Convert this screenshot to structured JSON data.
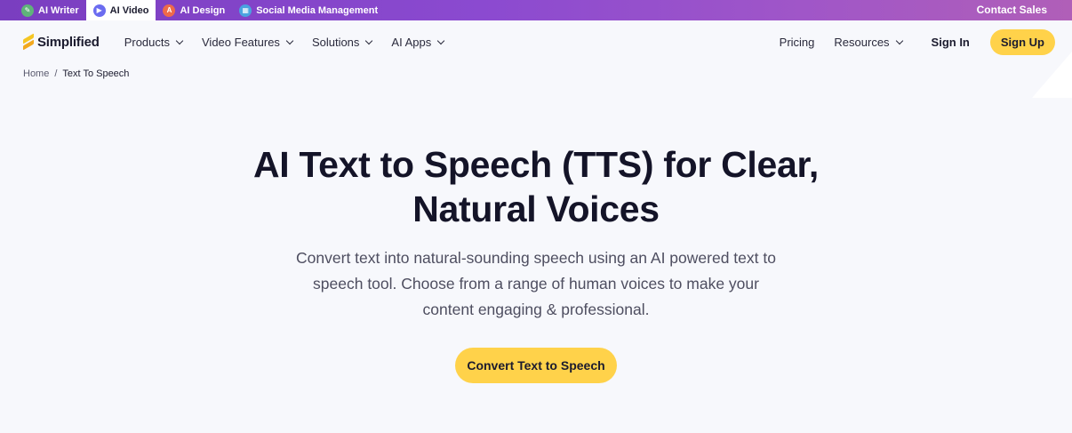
{
  "topbar": {
    "tabs": [
      {
        "label": "AI Writer",
        "icon": "writer-icon",
        "active": false
      },
      {
        "label": "AI Video",
        "icon": "video-icon",
        "active": true
      },
      {
        "label": "AI Design",
        "icon": "design-icon",
        "active": false
      },
      {
        "label": "Social Media Management",
        "icon": "calendar-icon",
        "active": false
      }
    ],
    "contact": "Contact Sales"
  },
  "nav": {
    "logo": "Simplified",
    "menu": [
      "Products",
      "Video Features",
      "Solutions",
      "AI Apps"
    ],
    "pricing": "Pricing",
    "resources": "Resources",
    "signin": "Sign In",
    "signup": "Sign Up"
  },
  "breadcrumb": {
    "home": "Home",
    "separator": "/",
    "current": "Text To Speech"
  },
  "hero": {
    "title_line1": "AI Text to Speech (TTS) for Clear,",
    "title_line2": "Natural Voices",
    "subtitle": "Convert text into natural-sounding speech using an AI powered text to speech tool. Choose from a range of human voices to make your content engaging & professional.",
    "cta": "Convert Text to Speech"
  },
  "colors": {
    "accent_yellow": "#ffd24a",
    "topbar_purple": "#8b4ad0",
    "background": "#f7f8fc"
  }
}
